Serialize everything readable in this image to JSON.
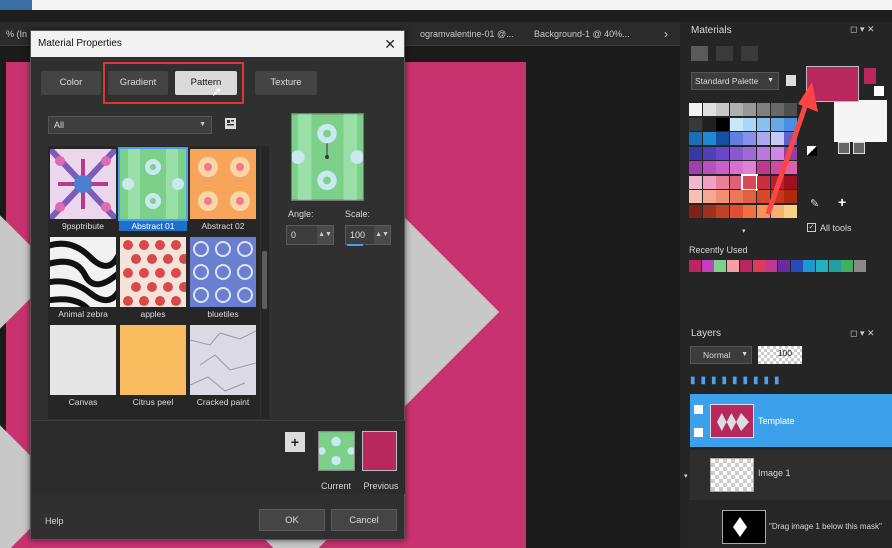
{
  "doc_tabs": [
    "% (In",
    "ogramvalentine-01 @...",
    "Background-1 @ 40%..."
  ],
  "dialog": {
    "title": "Material Properties",
    "tabs": [
      "Color",
      "Gradient",
      "Pattern",
      "Texture"
    ],
    "active_tab": "Pattern",
    "filter": "All",
    "patterns": [
      {
        "label": "9psptribute"
      },
      {
        "label": "Abstract 01",
        "selected": true
      },
      {
        "label": "Abstract 02"
      },
      {
        "label": "Animal zebra"
      },
      {
        "label": "apples"
      },
      {
        "label": "bluetiles"
      },
      {
        "label": "Canvas"
      },
      {
        "label": "Citrus peel"
      },
      {
        "label": "Cracked paint"
      }
    ],
    "angle_label": "Angle:",
    "angle_value": "0",
    "scale_label": "Scale:",
    "scale_value": "100",
    "current_label": "Current",
    "previous_label": "Previous",
    "help_label": "Help",
    "ok_label": "OK",
    "cancel_label": "Cancel"
  },
  "materials": {
    "title": "Materials",
    "palette": "Standard Palette",
    "all_tools": "All tools",
    "recently_used": "Recently Used",
    "fg_color": "#b8285c",
    "bg_color": "#f5f5f5"
  },
  "layers": {
    "title": "Layers",
    "blend_mode": "Normal",
    "opacity": "100",
    "items": [
      {
        "name": "Template"
      },
      {
        "name": "Image 1"
      },
      {
        "name": "\"Drag image 1 below this mask\""
      }
    ]
  },
  "colors": {
    "accent": "#3da0ea",
    "pink": "#c8336e",
    "highlight": "#e03535"
  }
}
